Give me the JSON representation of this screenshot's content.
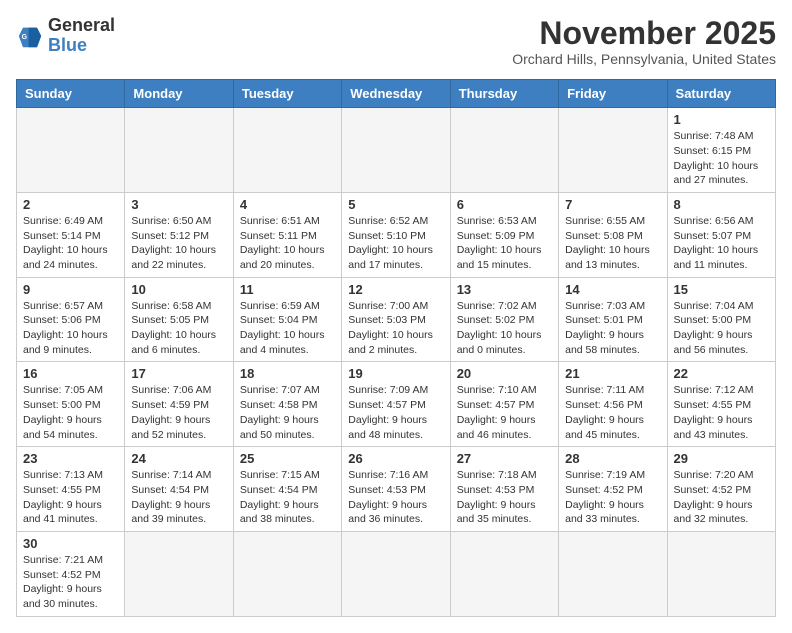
{
  "header": {
    "logo_general": "General",
    "logo_blue": "Blue",
    "month_title": "November 2025",
    "location": "Orchard Hills, Pennsylvania, United States"
  },
  "weekdays": [
    "Sunday",
    "Monday",
    "Tuesday",
    "Wednesday",
    "Thursday",
    "Friday",
    "Saturday"
  ],
  "weeks": [
    [
      {
        "day": "",
        "info": "",
        "empty": true
      },
      {
        "day": "",
        "info": "",
        "empty": true
      },
      {
        "day": "",
        "info": "",
        "empty": true
      },
      {
        "day": "",
        "info": "",
        "empty": true
      },
      {
        "day": "",
        "info": "",
        "empty": true
      },
      {
        "day": "",
        "info": "",
        "empty": true
      },
      {
        "day": "1",
        "info": "Sunrise: 7:48 AM\nSunset: 6:15 PM\nDaylight: 10 hours\nand 27 minutes."
      }
    ],
    [
      {
        "day": "2",
        "info": "Sunrise: 6:49 AM\nSunset: 5:14 PM\nDaylight: 10 hours\nand 24 minutes."
      },
      {
        "day": "3",
        "info": "Sunrise: 6:50 AM\nSunset: 5:12 PM\nDaylight: 10 hours\nand 22 minutes."
      },
      {
        "day": "4",
        "info": "Sunrise: 6:51 AM\nSunset: 5:11 PM\nDaylight: 10 hours\nand 20 minutes."
      },
      {
        "day": "5",
        "info": "Sunrise: 6:52 AM\nSunset: 5:10 PM\nDaylight: 10 hours\nand 17 minutes."
      },
      {
        "day": "6",
        "info": "Sunrise: 6:53 AM\nSunset: 5:09 PM\nDaylight: 10 hours\nand 15 minutes."
      },
      {
        "day": "7",
        "info": "Sunrise: 6:55 AM\nSunset: 5:08 PM\nDaylight: 10 hours\nand 13 minutes."
      },
      {
        "day": "8",
        "info": "Sunrise: 6:56 AM\nSunset: 5:07 PM\nDaylight: 10 hours\nand 11 minutes."
      }
    ],
    [
      {
        "day": "9",
        "info": "Sunrise: 6:57 AM\nSunset: 5:06 PM\nDaylight: 10 hours\nand 9 minutes."
      },
      {
        "day": "10",
        "info": "Sunrise: 6:58 AM\nSunset: 5:05 PM\nDaylight: 10 hours\nand 6 minutes."
      },
      {
        "day": "11",
        "info": "Sunrise: 6:59 AM\nSunset: 5:04 PM\nDaylight: 10 hours\nand 4 minutes."
      },
      {
        "day": "12",
        "info": "Sunrise: 7:00 AM\nSunset: 5:03 PM\nDaylight: 10 hours\nand 2 minutes."
      },
      {
        "day": "13",
        "info": "Sunrise: 7:02 AM\nSunset: 5:02 PM\nDaylight: 10 hours\nand 0 minutes."
      },
      {
        "day": "14",
        "info": "Sunrise: 7:03 AM\nSunset: 5:01 PM\nDaylight: 9 hours\nand 58 minutes."
      },
      {
        "day": "15",
        "info": "Sunrise: 7:04 AM\nSunset: 5:00 PM\nDaylight: 9 hours\nand 56 minutes."
      }
    ],
    [
      {
        "day": "16",
        "info": "Sunrise: 7:05 AM\nSunset: 5:00 PM\nDaylight: 9 hours\nand 54 minutes."
      },
      {
        "day": "17",
        "info": "Sunrise: 7:06 AM\nSunset: 4:59 PM\nDaylight: 9 hours\nand 52 minutes."
      },
      {
        "day": "18",
        "info": "Sunrise: 7:07 AM\nSunset: 4:58 PM\nDaylight: 9 hours\nand 50 minutes."
      },
      {
        "day": "19",
        "info": "Sunrise: 7:09 AM\nSunset: 4:57 PM\nDaylight: 9 hours\nand 48 minutes."
      },
      {
        "day": "20",
        "info": "Sunrise: 7:10 AM\nSunset: 4:57 PM\nDaylight: 9 hours\nand 46 minutes."
      },
      {
        "day": "21",
        "info": "Sunrise: 7:11 AM\nSunset: 4:56 PM\nDaylight: 9 hours\nand 45 minutes."
      },
      {
        "day": "22",
        "info": "Sunrise: 7:12 AM\nSunset: 4:55 PM\nDaylight: 9 hours\nand 43 minutes."
      }
    ],
    [
      {
        "day": "23",
        "info": "Sunrise: 7:13 AM\nSunset: 4:55 PM\nDaylight: 9 hours\nand 41 minutes."
      },
      {
        "day": "24",
        "info": "Sunrise: 7:14 AM\nSunset: 4:54 PM\nDaylight: 9 hours\nand 39 minutes."
      },
      {
        "day": "25",
        "info": "Sunrise: 7:15 AM\nSunset: 4:54 PM\nDaylight: 9 hours\nand 38 minutes."
      },
      {
        "day": "26",
        "info": "Sunrise: 7:16 AM\nSunset: 4:53 PM\nDaylight: 9 hours\nand 36 minutes."
      },
      {
        "day": "27",
        "info": "Sunrise: 7:18 AM\nSunset: 4:53 PM\nDaylight: 9 hours\nand 35 minutes."
      },
      {
        "day": "28",
        "info": "Sunrise: 7:19 AM\nSunset: 4:52 PM\nDaylight: 9 hours\nand 33 minutes."
      },
      {
        "day": "29",
        "info": "Sunrise: 7:20 AM\nSunset: 4:52 PM\nDaylight: 9 hours\nand 32 minutes."
      }
    ],
    [
      {
        "day": "30",
        "info": "Sunrise: 7:21 AM\nSunset: 4:52 PM\nDaylight: 9 hours\nand 30 minutes."
      },
      {
        "day": "",
        "info": "",
        "empty": true
      },
      {
        "day": "",
        "info": "",
        "empty": true
      },
      {
        "day": "",
        "info": "",
        "empty": true
      },
      {
        "day": "",
        "info": "",
        "empty": true
      },
      {
        "day": "",
        "info": "",
        "empty": true
      },
      {
        "day": "",
        "info": "",
        "empty": true
      }
    ]
  ]
}
